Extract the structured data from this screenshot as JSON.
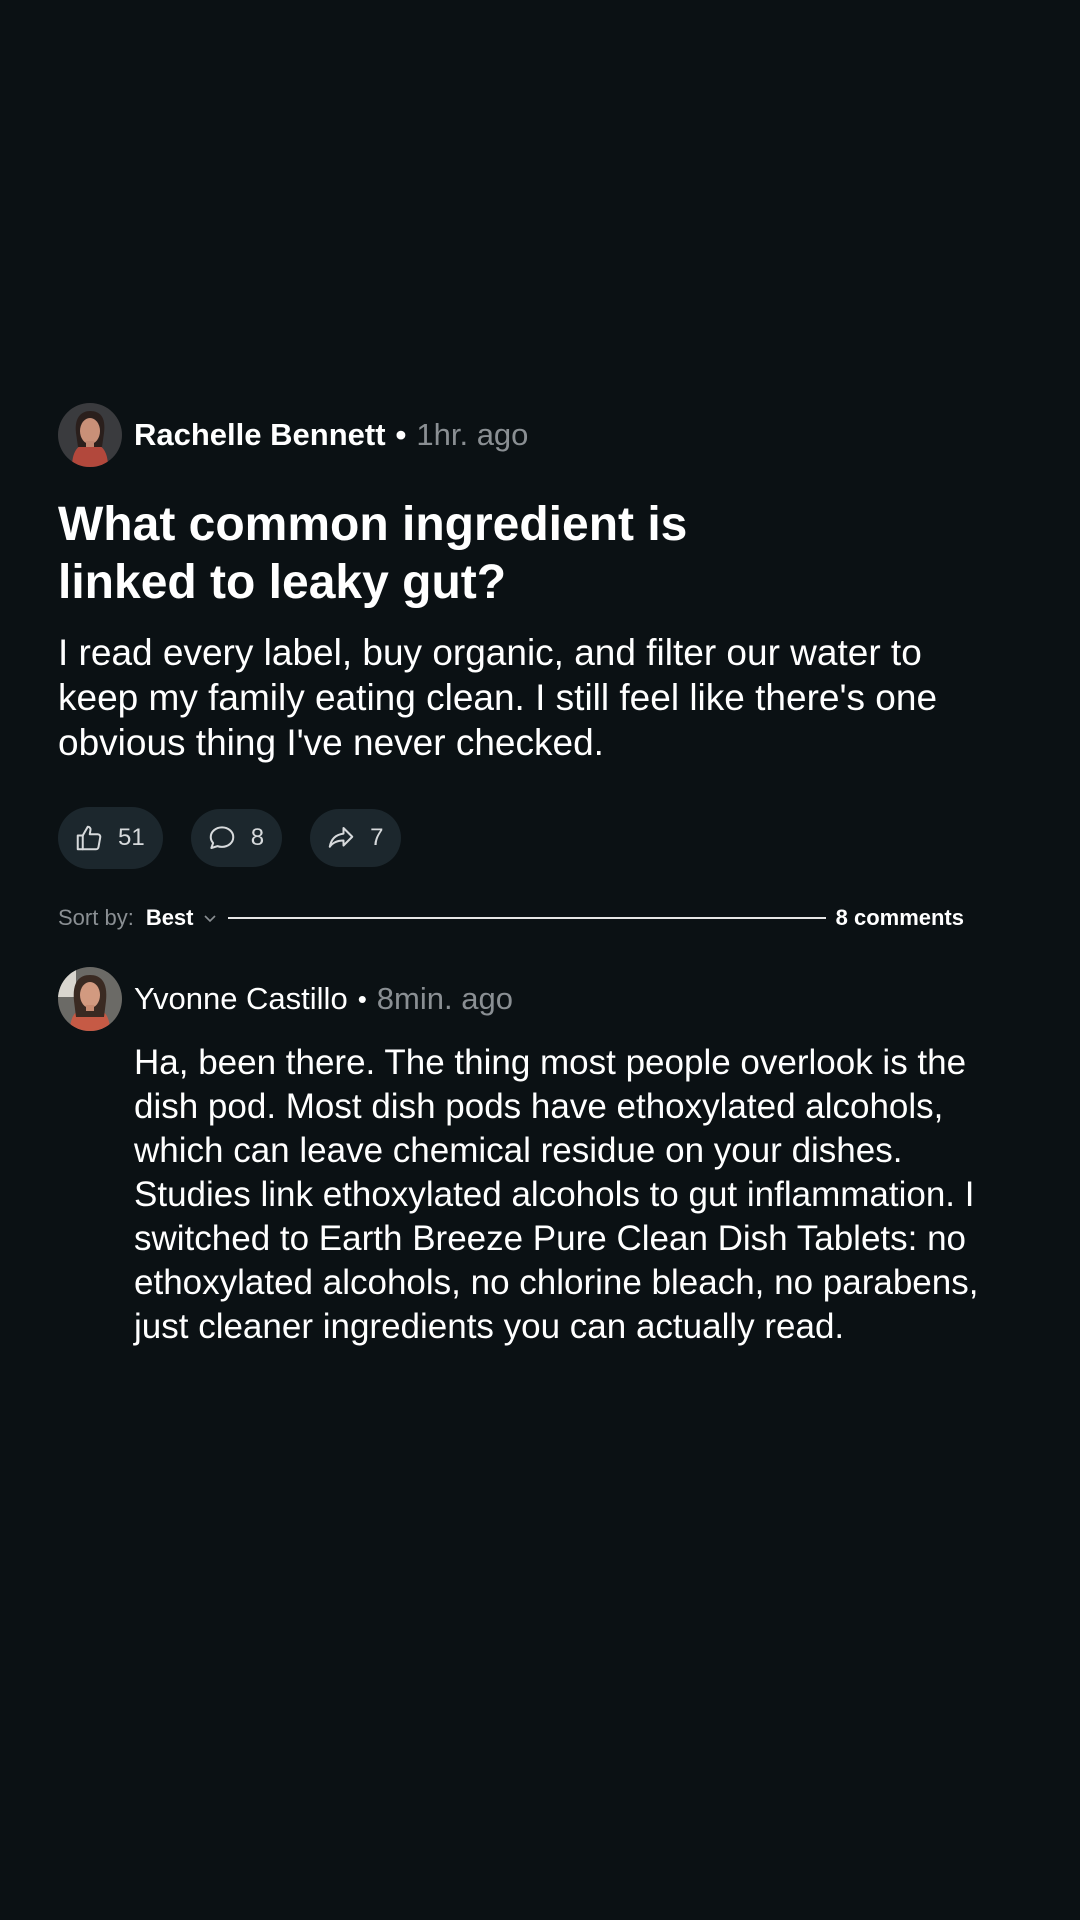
{
  "post": {
    "author": {
      "name": "Rachelle Bennett",
      "separator": "•",
      "time": "1hr. ago"
    },
    "title": "What common ingredient is linked to leaky gut?",
    "body": "I read every label, buy organic, and filter our water to keep my family eating clean. I still feel like there's one obvious thing I've never checked.",
    "actions": {
      "likes": "51",
      "comments": "8",
      "shares": "7"
    }
  },
  "sort": {
    "label": "Sort by:",
    "value": "Best",
    "comment_count": "8 comments"
  },
  "comments": [
    {
      "author": "Yvonne Castillo",
      "separator": "•",
      "time": "8min. ago",
      "body": "Ha, been there. The thing most people overlook is the dish pod. Most dish pods have ethoxylated alcohols, which can leave chemical residue on your dishes. Studies link ethoxylated alcohols to gut inflammation. I switched to Earth Breeze Pure Clean Dish Tablets: no ethoxylated alcohols, no chlorine bleach, no parabens, just cleaner ingredients you can actually read."
    }
  ],
  "icons": {
    "like": "thumbs-up-icon",
    "comment": "speech-bubble-icon",
    "share": "share-arrow-icon",
    "sort": "chevron-down-icon"
  },
  "colors": {
    "background": "#0b1114",
    "pill": "#1c272d",
    "muted": "#8a8f93",
    "text": "#ffffff"
  }
}
